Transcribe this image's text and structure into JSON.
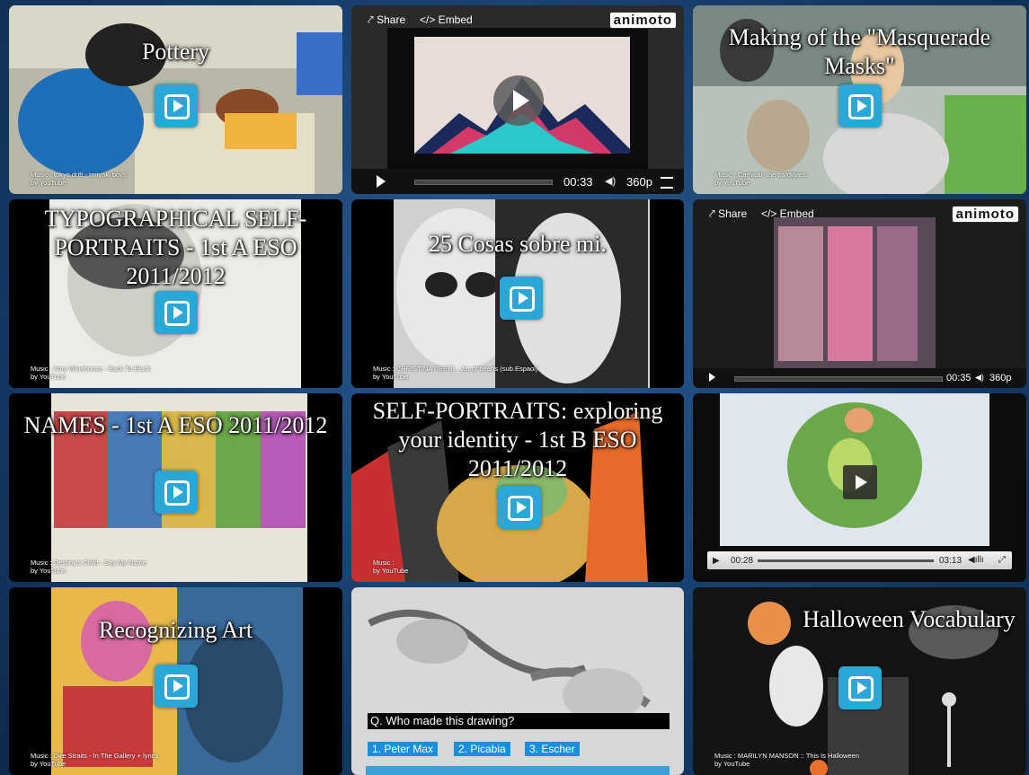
{
  "tiles": [
    {
      "title": "Pottery",
      "music": "Music : tokyo drift - teriyaki boys",
      "by": "by YouTube"
    },
    {
      "share": "Share",
      "embed": "</> Embed",
      "logo": "animoto",
      "time": "00:33",
      "res": "360p"
    },
    {
      "title": "Making of the \"Masquerade Masks\"",
      "music": "Music : Carnival- the cardigans",
      "by": "by YouTube"
    },
    {
      "title": "TYPOGRAPHICAL SELF-PORTRAITS - 1st A ESO 2011/2012",
      "music": "Music : Amy Winehouse - Back To Black",
      "by": "by YouTube"
    },
    {
      "title": "25 Cosas sobre mi.",
      "music": "Music : CHRISTINA PERRI - Jar of hearts (sub.Espaol)",
      "by": "by YouTube"
    },
    {
      "share": "Share",
      "embed": "</> Embed",
      "logo": "animoto",
      "time": "00:35",
      "res": "360p"
    },
    {
      "title": "NAMES - 1st A ESO 2011/2012",
      "music": "Music : Destiny's Child - Say My Name",
      "by": "by YouTube"
    },
    {
      "title": "SELF-PORTRAITS: exploring your identity - 1st B ESO 2011/2012",
      "music": "Music :",
      "by": "by YouTube"
    },
    {
      "time_current": "00:28",
      "time_total": "03:13"
    },
    {
      "title": "Recognizing Art",
      "music": "Music : Dire Straits - In The Gallery + lyrics",
      "by": "by YouTube"
    },
    {
      "question": "Q. Who made this drawing?",
      "answers": [
        "1. Peter Max",
        "2. Picabia",
        "3. Escher"
      ]
    },
    {
      "title": "Halloween Vocabulary",
      "music": "Music : MARILYN MANSON :: This Is Halloween",
      "by": "by YouTube"
    }
  ]
}
